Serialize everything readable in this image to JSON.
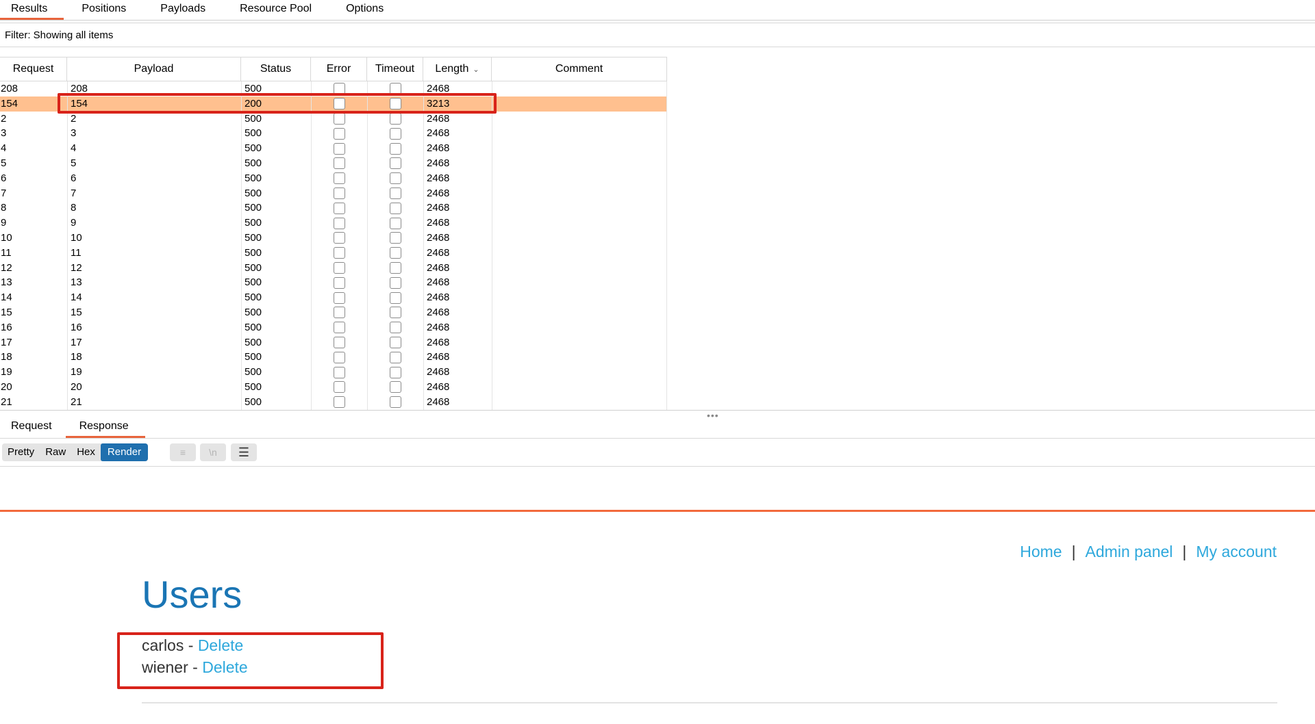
{
  "tabs": [
    "Results",
    "Positions",
    "Payloads",
    "Resource Pool",
    "Options"
  ],
  "filter": "Filter: Showing all items",
  "table": {
    "columns": [
      "Request",
      "Payload",
      "Status",
      "Error",
      "Timeout",
      "Length",
      "Comment"
    ],
    "sort_indicator": "chevron-down",
    "rows": [
      {
        "request": "208",
        "payload": "208",
        "status": "500",
        "error": false,
        "timeout": false,
        "length": "2468",
        "comment": ""
      },
      {
        "request": "154",
        "payload": "154",
        "status": "200",
        "error": false,
        "timeout": false,
        "length": "3213",
        "comment": "",
        "selected": true
      },
      {
        "request": "2",
        "payload": "2",
        "status": "500",
        "error": false,
        "timeout": false,
        "length": "2468",
        "comment": ""
      },
      {
        "request": "3",
        "payload": "3",
        "status": "500",
        "error": false,
        "timeout": false,
        "length": "2468",
        "comment": ""
      },
      {
        "request": "4",
        "payload": "4",
        "status": "500",
        "error": false,
        "timeout": false,
        "length": "2468",
        "comment": ""
      },
      {
        "request": "5",
        "payload": "5",
        "status": "500",
        "error": false,
        "timeout": false,
        "length": "2468",
        "comment": ""
      },
      {
        "request": "6",
        "payload": "6",
        "status": "500",
        "error": false,
        "timeout": false,
        "length": "2468",
        "comment": ""
      },
      {
        "request": "7",
        "payload": "7",
        "status": "500",
        "error": false,
        "timeout": false,
        "length": "2468",
        "comment": ""
      },
      {
        "request": "8",
        "payload": "8",
        "status": "500",
        "error": false,
        "timeout": false,
        "length": "2468",
        "comment": ""
      },
      {
        "request": "9",
        "payload": "9",
        "status": "500",
        "error": false,
        "timeout": false,
        "length": "2468",
        "comment": ""
      },
      {
        "request": "10",
        "payload": "10",
        "status": "500",
        "error": false,
        "timeout": false,
        "length": "2468",
        "comment": ""
      },
      {
        "request": "11",
        "payload": "11",
        "status": "500",
        "error": false,
        "timeout": false,
        "length": "2468",
        "comment": ""
      },
      {
        "request": "12",
        "payload": "12",
        "status": "500",
        "error": false,
        "timeout": false,
        "length": "2468",
        "comment": ""
      },
      {
        "request": "13",
        "payload": "13",
        "status": "500",
        "error": false,
        "timeout": false,
        "length": "2468",
        "comment": ""
      },
      {
        "request": "14",
        "payload": "14",
        "status": "500",
        "error": false,
        "timeout": false,
        "length": "2468",
        "comment": ""
      },
      {
        "request": "15",
        "payload": "15",
        "status": "500",
        "error": false,
        "timeout": false,
        "length": "2468",
        "comment": ""
      },
      {
        "request": "16",
        "payload": "16",
        "status": "500",
        "error": false,
        "timeout": false,
        "length": "2468",
        "comment": ""
      },
      {
        "request": "17",
        "payload": "17",
        "status": "500",
        "error": false,
        "timeout": false,
        "length": "2468",
        "comment": ""
      },
      {
        "request": "18",
        "payload": "18",
        "status": "500",
        "error": false,
        "timeout": false,
        "length": "2468",
        "comment": ""
      },
      {
        "request": "19",
        "payload": "19",
        "status": "500",
        "error": false,
        "timeout": false,
        "length": "2468",
        "comment": ""
      },
      {
        "request": "20",
        "payload": "20",
        "status": "500",
        "error": false,
        "timeout": false,
        "length": "2468",
        "comment": ""
      },
      {
        "request": "21",
        "payload": "21",
        "status": "500",
        "error": false,
        "timeout": false,
        "length": "2468",
        "comment": ""
      }
    ]
  },
  "message_tabs": [
    "Request",
    "Response"
  ],
  "view_modes": [
    "Pretty",
    "Raw",
    "Hex",
    "Render"
  ],
  "tool_icons": [
    "wrap-lines-icon",
    "newline-icon",
    "menu-icon"
  ],
  "tool_glyphs": [
    "≡",
    "\\n",
    "☰"
  ],
  "render": {
    "nav": [
      {
        "label": "Home"
      },
      {
        "label": "Admin panel"
      },
      {
        "label": "My account"
      }
    ],
    "nav_separator": "|",
    "heading": "Users",
    "users": [
      {
        "name": "carlos",
        "sep": " - ",
        "action": "Delete"
      },
      {
        "name": "wiener",
        "sep": " - ",
        "action": "Delete"
      }
    ]
  },
  "colors": {
    "accent": "#e8643c",
    "selected_row": "#ffc08f",
    "highlight_box": "#d8231a",
    "render_active": "#1f6fae",
    "link": "#2ea8dc",
    "heading": "#1a75b4"
  }
}
